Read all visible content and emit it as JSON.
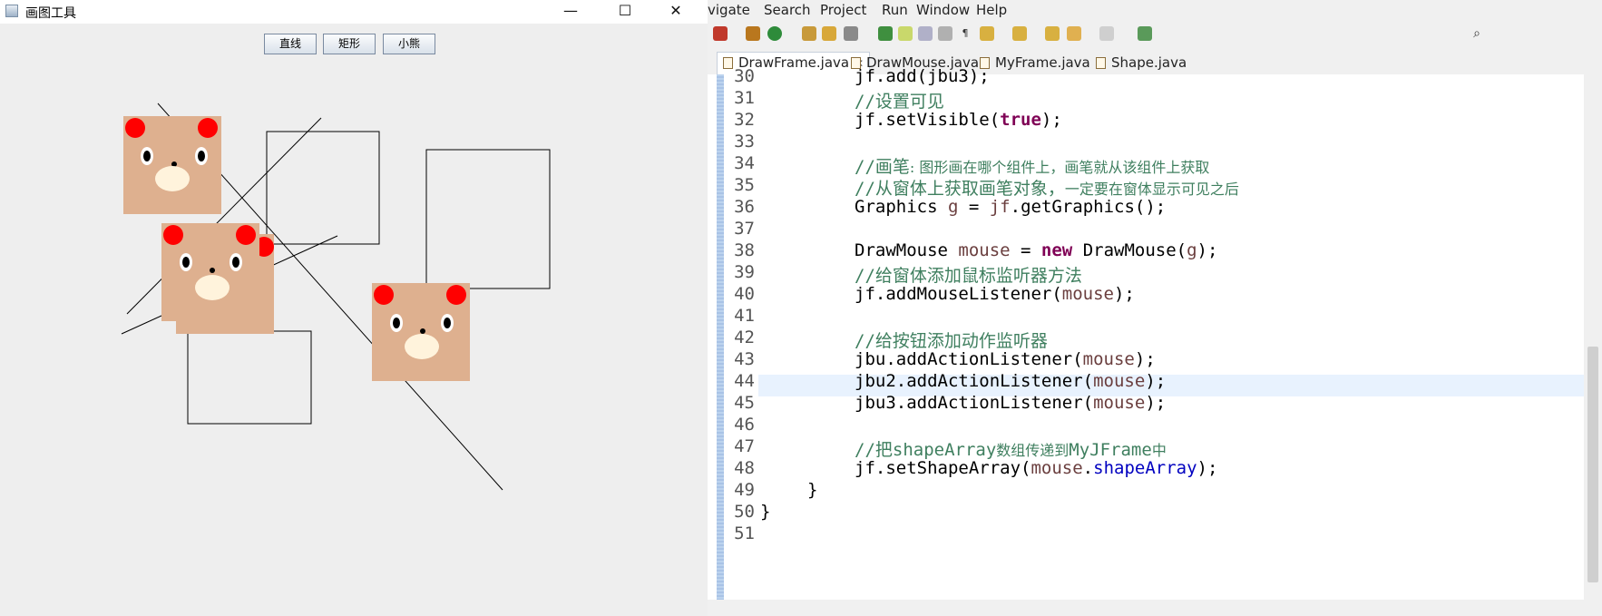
{
  "swing": {
    "title": "画图工具",
    "window_controls": {
      "minimize": "—",
      "maximize": "☐",
      "close": "✕"
    },
    "tools": {
      "line": "直线",
      "rect": "矩形",
      "bear": "小熊"
    }
  },
  "eclipse": {
    "menus": [
      "vigate",
      "Search",
      "Project",
      "Run",
      "Window",
      "Help"
    ],
    "tabs": {
      "active": "DrawFrame.java",
      "tab2": "DrawMouse.java",
      "tab3": "MyFrame.java",
      "tab4": "Shape.java"
    },
    "close_glyph": "✕",
    "line_numbers": [
      "30",
      "31",
      "32",
      "33",
      "34",
      "35",
      "36",
      "37",
      "38",
      "39",
      "40",
      "41",
      "42",
      "43",
      "44",
      "45",
      "46",
      "47",
      "48",
      "49",
      "50",
      "51"
    ],
    "code": {
      "l30": "jf.add(jbu3);",
      "l31": "//设置可见",
      "l32a": "jf.setVisible(",
      "l32b": "true",
      "l32c": ");",
      "l34a": "//画笔",
      "l34b": ": 图形画在哪个组件上，画笔就从该组件上获取",
      "l35a": "//从窗体上获取画笔对象，",
      "l35b": "一定要在窗体显示可见之后",
      "l36a": "Graphics ",
      "l36b": "g",
      "l36c": " = ",
      "l36d": "jf",
      "l36e": ".getGraphics();",
      "l38a": "DrawMouse ",
      "l38b": "mouse",
      "l38c": " = ",
      "l38d": "new",
      "l38e": " DrawMouse(",
      "l38f": "g",
      "l38g": ");",
      "l39": "//给窗体添加鼠标监听器方法",
      "l40a": "jf.addMouseListener(",
      "l40b": "mouse",
      "l40c": ");",
      "l42": "//给按钮添加动作监听器",
      "l43a": "jbu.addActionListener(",
      "l43b": "mouse",
      "l43c": ");",
      "l44a": "jbu2.addActionListener(",
      "l44b": "mouse",
      "l44c": ");",
      "l45a": "jbu3.addActionListener(",
      "l45b": "mouse",
      "l45c": ");",
      "l47a": "//把",
      "l47b": "shapeArray",
      "l47c": "数组传递到",
      "l47d": "MyJFrame",
      "l47e": "中",
      "l48a": "jf.setShapeArray(",
      "l48b": "mouse",
      "l48c": ".",
      "l48d": "shapeArray",
      "l48e": ");",
      "l49": "}",
      "l50": "}"
    }
  },
  "colors": {
    "bear_face": "#deb08f",
    "bear_ear": "#ff0000",
    "bear_nose": "#fff3dc",
    "line": "#000000"
  }
}
